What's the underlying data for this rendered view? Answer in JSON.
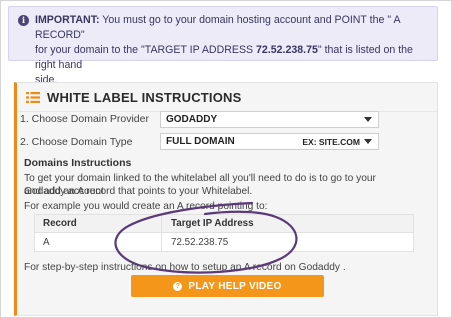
{
  "alert": {
    "icon": "info-icon",
    "strong": "IMPORTANT:",
    "line1_rest": " You must go to your domain hosting account and POINT the \" A RECORD\"",
    "line2_pre": "for your domain to the \"TARGET IP ADDRESS ",
    "ip": "72.52.238.75",
    "line2_post": "\" that is listed on the right hand",
    "line3": "side."
  },
  "panel": {
    "title": "WHITE LABEL INSTRUCTIONS",
    "title_icon": "list-icon",
    "accent_color": "#f08a14",
    "provider": {
      "label": "1. Choose Domain Provider",
      "value": "GODADDY"
    },
    "domain_type": {
      "label": "2. Choose Domain Type",
      "value": "FULL DOMAIN",
      "example": "EX: SITE.COM"
    },
    "instructions_heading": "Domains Instructions",
    "para1_line1": "To get your domain linked to the whitelabel all you'll need to do is to go to your Godaddy account",
    "para1_line2": "and add an A record that points to your Whitelabel.",
    "example_text": "For example you would create an A record pointing to:",
    "table": {
      "headers": [
        "Record",
        "Target IP Address"
      ],
      "rows": [
        [
          "A",
          "72.52.238.75"
        ]
      ]
    },
    "steps_text": "For step-by-step instructions on how to setup an A record on Godaddy .",
    "video_button": "PLAY HELP VIDEO",
    "button_color": "#f39619",
    "annotation_color": "#5b3a78"
  }
}
